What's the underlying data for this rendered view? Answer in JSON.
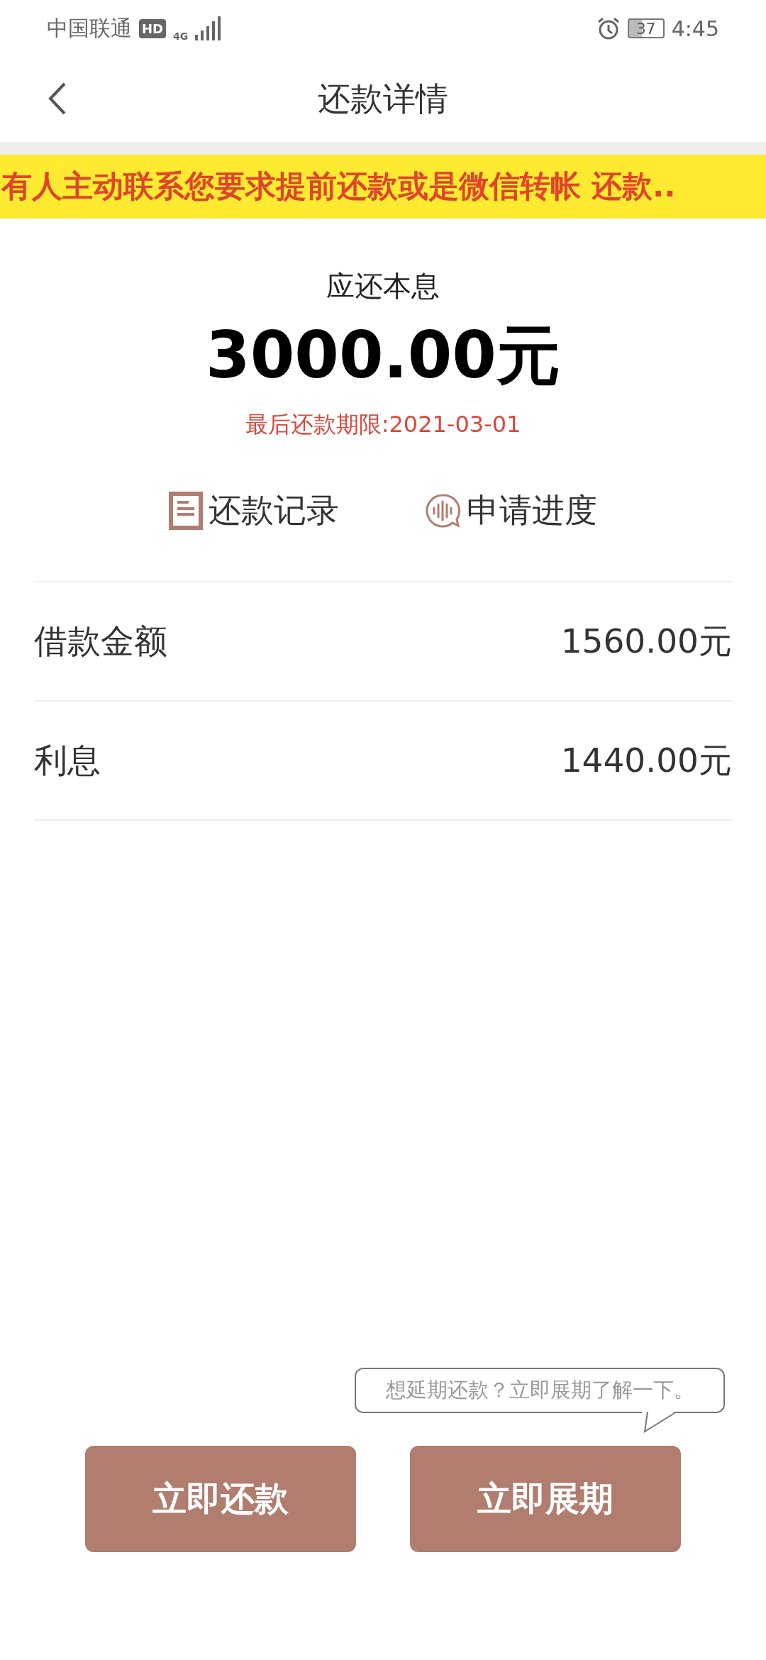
{
  "status_bar": {
    "carrier": "中国联通",
    "hd_badge": "HD",
    "network": "4G",
    "battery": "37",
    "time": "4:45"
  },
  "header": {
    "title": "还款详情"
  },
  "banner": {
    "text": "有人主动联系您要求提前还款或是微信转帐 还款.."
  },
  "summary": {
    "label": "应还本息",
    "amount": "3000.00元",
    "deadline": "最后还款期限:2021-03-01"
  },
  "links": [
    {
      "kind": "record",
      "label": "还款记录"
    },
    {
      "kind": "progress",
      "label": "申请进度"
    }
  ],
  "details": [
    {
      "label": "借款金额",
      "value": "1560.00元"
    },
    {
      "label": "利息",
      "value": "1440.00元"
    }
  ],
  "tooltip": {
    "text": "想延期还款？立即展期了解一下。"
  },
  "buttons": [
    "立即还款",
    "立即展期"
  ]
}
